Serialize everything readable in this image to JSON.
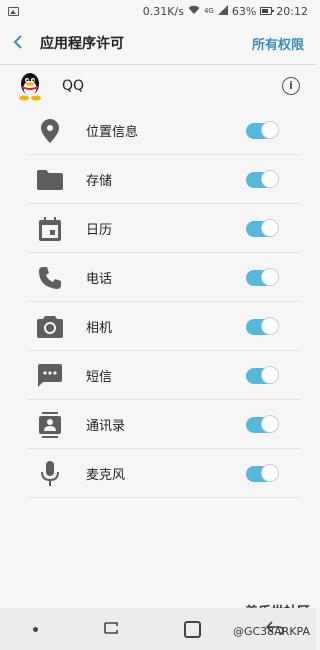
{
  "status": {
    "speed": "0.31K/s",
    "network": "4G",
    "battery": "63%",
    "time": "20:12"
  },
  "header": {
    "title": "应用程序许可",
    "all_permissions": "所有权限"
  },
  "app": {
    "name": "QQ"
  },
  "permissions": [
    {
      "label": "位置信息",
      "enabled": true,
      "icon": "location-icon"
    },
    {
      "label": "存储",
      "enabled": true,
      "icon": "folder-icon"
    },
    {
      "label": "日历",
      "enabled": true,
      "icon": "calendar-icon"
    },
    {
      "label": "电话",
      "enabled": true,
      "icon": "phone-icon"
    },
    {
      "label": "相机",
      "enabled": true,
      "icon": "camera-icon"
    },
    {
      "label": "短信",
      "enabled": true,
      "icon": "sms-icon"
    },
    {
      "label": "通讯录",
      "enabled": true,
      "icon": "contacts-icon"
    },
    {
      "label": "麦克风",
      "enabled": true,
      "icon": "microphone-icon"
    }
  ],
  "watermark": {
    "line1": "盖乐世社区",
    "line2": "@GC38ARKPA"
  },
  "colors": {
    "accent": "#3b8eb5",
    "toggle_on": "#58b7dd"
  }
}
